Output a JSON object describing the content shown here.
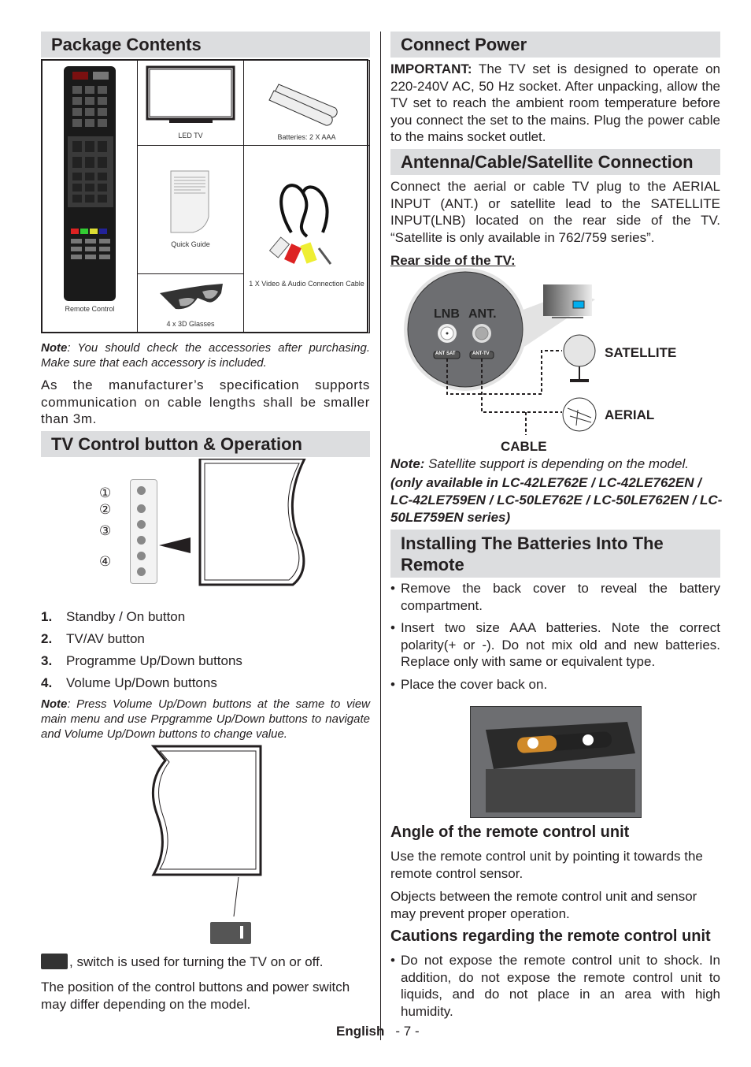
{
  "left": {
    "package": {
      "title": "Package Contents",
      "items": {
        "remote": "Remote Control",
        "tv": "LED TV",
        "batteries": "Batteries: 2 X AAA",
        "guide": "Quick Guide",
        "cable": "1 X Video & Audio Connection Cable",
        "glasses": "4 x 3D Glasses"
      },
      "note_label": "Note",
      "note_text": ": You should check the accessories after purchasing. Make sure that each accessory is included.",
      "spec": "As the manufacturer’s specification supports communication on cable lengths shall be smaller than 3m."
    },
    "control": {
      "title": "TV Control button & Operation",
      "callouts": [
        "①",
        "②",
        "③",
        "④"
      ],
      "list": [
        {
          "n": "1.",
          "t": "Standby / On button"
        },
        {
          "n": "2.",
          "t": "TV/AV button"
        },
        {
          "n": "3.",
          "t": "Programme Up/Down buttons"
        },
        {
          "n": "4.",
          "t": "Volume Up/Down buttons"
        }
      ],
      "note_label": "Note",
      "note_text": ": Press Volume Up/Down buttons at the same to view main menu and use Prpgramme Up/Down buttons to navigate and Volume Up/Down buttons to change value.",
      "switch_text": ", switch is used for turning the TV on or off.",
      "position_text": "The position of the control buttons and power switch may differ depending on the model."
    }
  },
  "right": {
    "power": {
      "title": "Connect Power",
      "important": "IMPORTANT:",
      "text": " The TV set is designed to operate on 220-240V AC, 50 Hz socket. After unpacking, allow the TV set to reach the ambient room temperature before you connect the set to the mains. Plug the power cable to the mains socket outlet."
    },
    "antenna": {
      "title": "Antenna/Cable/Satellite Connection",
      "text": "Connect the aerial or cable TV plug to the AERIAL INPUT (ANT.) or satellite lead to the SATELLITE INPUT(LNB) located on the rear side of the TV. “Satellite is only available in 762/759 series”.",
      "rear_label": "Rear side of the TV:",
      "diagram": {
        "lnb": "LNB",
        "ant": "ANT.",
        "ant_sat": "ANT SAT",
        "ant_tv": "ANT-TV",
        "satellite": "SATELLITE",
        "aerial": "AERIAL",
        "cable": "CABLE"
      },
      "note_label": "Note:",
      "note_text": " Satellite support is depending on the model.",
      "models": "(only available in LC-42LE762E / LC-42LE762EN / LC-42LE759EN / LC-50LE762E / LC-50LE762EN / LC-50LE759EN series)"
    },
    "batteries": {
      "title": "Installing The Batteries Into The Remote",
      "bullets": [
        "Remove the back cover to reveal the battery compartment.",
        "Insert two size AAA batteries. Note the correct polarity(+ or -). Do not mix old and new batteries. Replace only with same or equivalent type.",
        "Place the cover back on."
      ]
    },
    "angle": {
      "title": "Angle of the remote control unit",
      "p1": "Use the remote control unit by pointing it towards the remote control sensor.",
      "p2": "Objects between the remote control unit and sensor may prevent proper operation."
    },
    "cautions": {
      "title": "Cautions regarding the remote control unit",
      "bullets": [
        "Do not expose the remote control unit to shock. In addition, do not expose the remote control unit to liquids, and do not place in an area with high humidity."
      ]
    }
  },
  "footer": {
    "language": "English",
    "page": "- 7 -"
  }
}
